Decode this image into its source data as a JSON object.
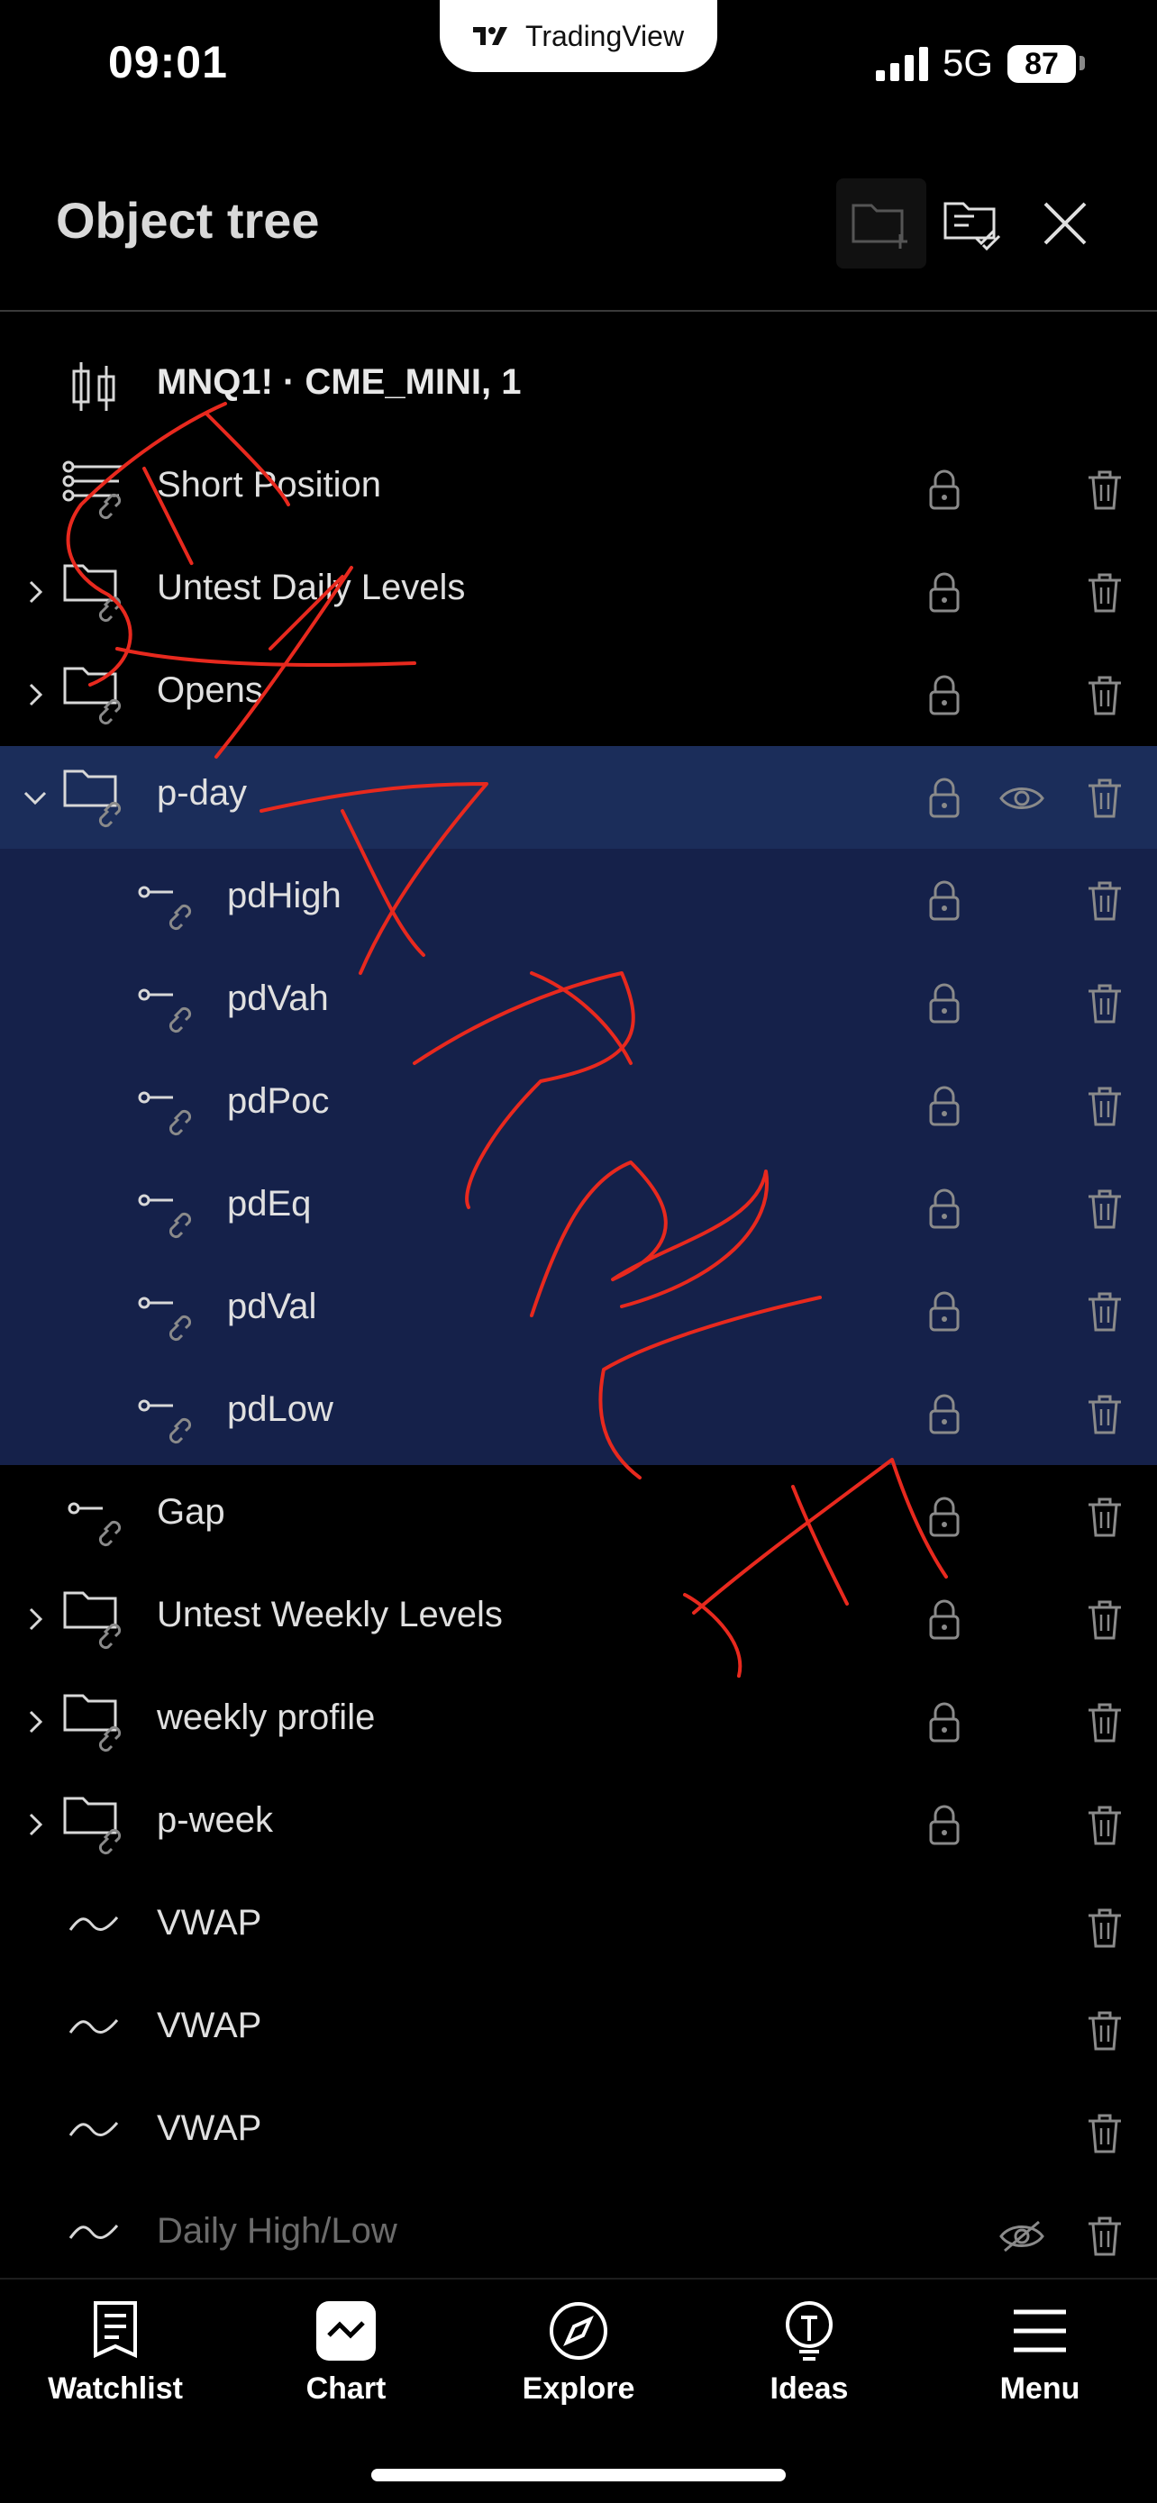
{
  "status_bar": {
    "time": "09:01",
    "network": "5G",
    "battery": "87",
    "brand": "TradingView"
  },
  "header": {
    "title": "Object tree"
  },
  "tree": [
    {
      "label": "MNQ1! · CME_MINI, 1",
      "icon": "candlestick-icon",
      "level": 0,
      "chevron": "none",
      "bold": true,
      "lock": false,
      "trash": false,
      "eye": "none",
      "selected": "none",
      "dim": false
    },
    {
      "label": "Short Position",
      "icon": "position-tool-icon",
      "level": 0,
      "chevron": "none",
      "bold": false,
      "lock": true,
      "trash": true,
      "eye": "none",
      "selected": "none",
      "dim": false
    },
    {
      "label": "Untest Daily Levels",
      "icon": "folder-link-icon",
      "level": 0,
      "chevron": "right",
      "bold": false,
      "lock": true,
      "trash": true,
      "eye": "none",
      "selected": "none",
      "dim": false
    },
    {
      "label": "Opens",
      "icon": "folder-link-icon",
      "level": 0,
      "chevron": "right",
      "bold": false,
      "lock": true,
      "trash": true,
      "eye": "none",
      "selected": "none",
      "dim": false
    },
    {
      "label": "p-day",
      "icon": "folder-link-icon",
      "level": 0,
      "chevron": "down",
      "bold": false,
      "lock": true,
      "trash": true,
      "eye": "visible",
      "selected": "head",
      "dim": false
    },
    {
      "label": "pdHigh",
      "icon": "horizontal-ray-link-icon",
      "level": 1,
      "chevron": "none",
      "bold": false,
      "lock": true,
      "trash": true,
      "eye": "none",
      "selected": "child",
      "dim": false
    },
    {
      "label": "pdVah",
      "icon": "horizontal-ray-link-icon",
      "level": 1,
      "chevron": "none",
      "bold": false,
      "lock": true,
      "trash": true,
      "eye": "none",
      "selected": "child",
      "dim": false
    },
    {
      "label": "pdPoc",
      "icon": "horizontal-ray-link-icon",
      "level": 1,
      "chevron": "none",
      "bold": false,
      "lock": true,
      "trash": true,
      "eye": "none",
      "selected": "child",
      "dim": false
    },
    {
      "label": "pdEq",
      "icon": "horizontal-ray-link-icon",
      "level": 1,
      "chevron": "none",
      "bold": false,
      "lock": true,
      "trash": true,
      "eye": "none",
      "selected": "child",
      "dim": false
    },
    {
      "label": "pdVal",
      "icon": "horizontal-ray-link-icon",
      "level": 1,
      "chevron": "none",
      "bold": false,
      "lock": true,
      "trash": true,
      "eye": "none",
      "selected": "child",
      "dim": false
    },
    {
      "label": "pdLow",
      "icon": "horizontal-ray-link-icon",
      "level": 1,
      "chevron": "none",
      "bold": false,
      "lock": true,
      "trash": true,
      "eye": "none",
      "selected": "child",
      "dim": false
    },
    {
      "label": "Gap",
      "icon": "horizontal-ray-link-icon",
      "level": 0,
      "chevron": "none",
      "bold": false,
      "lock": true,
      "trash": true,
      "eye": "none",
      "selected": "none",
      "dim": false
    },
    {
      "label": "Untest Weekly Levels",
      "icon": "folder-link-icon",
      "level": 0,
      "chevron": "right",
      "bold": false,
      "lock": true,
      "trash": true,
      "eye": "none",
      "selected": "none",
      "dim": false
    },
    {
      "label": "weekly profile",
      "icon": "folder-link-icon",
      "level": 0,
      "chevron": "right",
      "bold": false,
      "lock": true,
      "trash": true,
      "eye": "none",
      "selected": "none",
      "dim": false
    },
    {
      "label": "p-week",
      "icon": "folder-link-icon",
      "level": 0,
      "chevron": "right",
      "bold": false,
      "lock": true,
      "trash": true,
      "eye": "none",
      "selected": "none",
      "dim": false
    },
    {
      "label": "VWAP",
      "icon": "indicator-wave-icon",
      "level": 0,
      "chevron": "none",
      "bold": false,
      "lock": false,
      "trash": true,
      "eye": "none",
      "selected": "none",
      "dim": false
    },
    {
      "label": "VWAP",
      "icon": "indicator-wave-icon",
      "level": 0,
      "chevron": "none",
      "bold": false,
      "lock": false,
      "trash": true,
      "eye": "none",
      "selected": "none",
      "dim": false
    },
    {
      "label": "VWAP",
      "icon": "indicator-wave-icon",
      "level": 0,
      "chevron": "none",
      "bold": false,
      "lock": false,
      "trash": true,
      "eye": "none",
      "selected": "none",
      "dim": false
    },
    {
      "label": "Daily High/Low",
      "icon": "indicator-wave-icon",
      "level": 0,
      "chevron": "none",
      "bold": false,
      "lock": false,
      "trash": true,
      "eye": "hidden",
      "selected": "none",
      "dim": true
    }
  ],
  "bottom_nav": [
    {
      "label": "Watchlist",
      "icon": "watchlist-icon"
    },
    {
      "label": "Chart",
      "icon": "chart-icon"
    },
    {
      "label": "Explore",
      "icon": "compass-icon"
    },
    {
      "label": "Ideas",
      "icon": "lightbulb-icon"
    },
    {
      "label": "Menu",
      "icon": "hamburger-icon"
    }
  ],
  "colors": {
    "selected_head": "#1b2d5a",
    "selected_child": "#15214a",
    "annotation": "#e8291e"
  },
  "annotation": {
    "type": "handwritten-watermark"
  }
}
